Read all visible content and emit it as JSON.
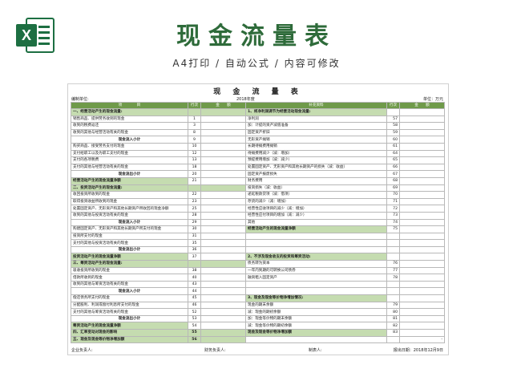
{
  "header": {
    "title": "现金流量表",
    "subtitle": "A4打印 / 自动公式 / 内容可修改"
  },
  "sheet": {
    "title": "现 金 流 量 表",
    "unit_left": "编制单位:",
    "period": "2018年度",
    "unit_right": "单位：万元",
    "col_headers": [
      "项　　　　目",
      "行次",
      "金　　额",
      "补充资料",
      "行次",
      "金　　额"
    ],
    "left_rows": [
      {
        "t": "一、经营活动产生的现金流量:",
        "n": "",
        "s": "sec"
      },
      {
        "t": "销售商品、提供劳务收到的现金",
        "n": "1",
        "s": ""
      },
      {
        "t": "收到的税费返还",
        "n": "3",
        "s": ""
      },
      {
        "t": "收到的其他与经营活动有关的现金",
        "n": "8",
        "s": ""
      },
      {
        "t": "现金流入小计",
        "n": "9",
        "s": "sub"
      },
      {
        "t": "购买商品、接受劳务支付的现金",
        "n": "10",
        "s": ""
      },
      {
        "t": "支付给职工以及为职工支付的现金",
        "n": "12",
        "s": ""
      },
      {
        "t": "支付的各项税费",
        "n": "13",
        "s": ""
      },
      {
        "t": "支付的其他与经营活动有关的现金",
        "n": "18",
        "s": ""
      },
      {
        "t": "现金流出小计",
        "n": "20",
        "s": "sub"
      },
      {
        "t": "经营活动产生的现金流量净额",
        "n": "21",
        "s": "sum"
      },
      {
        "t": "二、投资活动产生的现金流量:",
        "n": "",
        "s": "sec"
      },
      {
        "t": "收回投资所收到的现金",
        "n": "22",
        "s": ""
      },
      {
        "t": "取得投资收益所收到的现金",
        "n": "23",
        "s": ""
      },
      {
        "t": "处置固定资产、无形资产和其他长期资产所收回的现金净额",
        "n": "25",
        "s": ""
      },
      {
        "t": "收到的其他与投资活动有关的现金",
        "n": "28",
        "s": ""
      },
      {
        "t": "现金流入小计",
        "n": "29",
        "s": "sub"
      },
      {
        "t": "购建固定资产、无形资产和其他长期资产所支付的现金",
        "n": "30",
        "s": ""
      },
      {
        "t": "投资所支付的现金",
        "n": "31",
        "s": ""
      },
      {
        "t": "支付的其他与投资活动有关的现金",
        "n": "35",
        "s": ""
      },
      {
        "t": "现金流出小计",
        "n": "36",
        "s": "sub"
      },
      {
        "t": "投资活动产生的现金流量净额",
        "n": "37",
        "s": "sum"
      },
      {
        "t": "三、筹资活动产生的现金流量:",
        "n": "",
        "s": "sec"
      },
      {
        "t": "吸收投资所收到的现金",
        "n": "38",
        "s": ""
      },
      {
        "t": "借款所收到的现金",
        "n": "40",
        "s": ""
      },
      {
        "t": "收到的其他与筹资活动有关的现金",
        "n": "43",
        "s": ""
      },
      {
        "t": "现金流入小计",
        "n": "44",
        "s": "sub"
      },
      {
        "t": "偿还债务所支付的现金",
        "n": "45",
        "s": ""
      },
      {
        "t": "分配股利、利润或偿付利息所支付的现金",
        "n": "46",
        "s": ""
      },
      {
        "t": "支付的其他与筹资活动有关的现金",
        "n": "52",
        "s": ""
      },
      {
        "t": "现金流出小计",
        "n": "53",
        "s": "sub"
      },
      {
        "t": "筹资活动产生的现金流量净额",
        "n": "54",
        "s": "sum"
      },
      {
        "t": "四、汇率变动对现金的影响",
        "n": "55",
        "s": "sec"
      },
      {
        "t": "五、现金及现金等价物净增加额",
        "n": "56",
        "s": "sec"
      }
    ],
    "right_rows": [
      {
        "t": "1、将净利润调节为经营活动现金流量:",
        "n": "",
        "s": "bold"
      },
      {
        "t": "净利润",
        "n": "57",
        "s": ""
      },
      {
        "t": "加：计提的资产减值准备",
        "n": "58",
        "s": ""
      },
      {
        "t": "固定资产折旧",
        "n": "59",
        "s": ""
      },
      {
        "t": "无形资产摊销",
        "n": "60",
        "s": ""
      },
      {
        "t": "长期待摊费用摊销",
        "n": "61",
        "s": ""
      },
      {
        "t": "待摊费用减少（减：增加）",
        "n": "64",
        "s": ""
      },
      {
        "t": "预提费用增加（减：减少）",
        "n": "65",
        "s": ""
      },
      {
        "t": "处置固定资产、无形资产和其他长期资产的损失（减：收益）",
        "n": "66",
        "s": ""
      },
      {
        "t": "固定资产报废损失",
        "n": "67",
        "s": ""
      },
      {
        "t": "财务费用",
        "n": "68",
        "s": ""
      },
      {
        "t": "投资损失（减：收益）",
        "n": "69",
        "s": ""
      },
      {
        "t": "递延税款贷项（减：借项）",
        "n": "70",
        "s": ""
      },
      {
        "t": "存货的减少（减：增加）",
        "n": "71",
        "s": ""
      },
      {
        "t": "经营性应收项目的减少（减：增加）",
        "n": "72",
        "s": ""
      },
      {
        "t": "经营性应付项目的增加（减：减少）",
        "n": "73",
        "s": ""
      },
      {
        "t": "其他",
        "n": "74",
        "s": ""
      },
      {
        "t": "经营活动产生的现金流量净额",
        "n": "75",
        "s": "bold"
      },
      {
        "t": "",
        "n": "",
        "s": ""
      },
      {
        "t": "",
        "n": "",
        "s": ""
      },
      {
        "t": "",
        "n": "",
        "s": ""
      },
      {
        "t": "2、不涉及现金收支的投资和筹资活动:",
        "n": "",
        "s": "bold"
      },
      {
        "t": "债务转为资本",
        "n": "76",
        "s": ""
      },
      {
        "t": "一年内到期的可转换公司债券",
        "n": "77",
        "s": ""
      },
      {
        "t": "融资租入固定资产",
        "n": "78",
        "s": ""
      },
      {
        "t": "",
        "n": "",
        "s": ""
      },
      {
        "t": "",
        "n": "",
        "s": ""
      },
      {
        "t": "3、现金及现金等价物净增加情况:",
        "n": "",
        "s": "bold"
      },
      {
        "t": "现金的期末余额",
        "n": "79",
        "s": ""
      },
      {
        "t": "减：现金的期初余额",
        "n": "80",
        "s": ""
      },
      {
        "t": "加：现金等价物的期末余额",
        "n": "81",
        "s": ""
      },
      {
        "t": "减：现金等价物的期初余额",
        "n": "82",
        "s": ""
      },
      {
        "t": "现金及现金等价物净增加额",
        "n": "83",
        "s": "bold"
      },
      {
        "t": "",
        "n": "",
        "s": ""
      }
    ],
    "last_amount": "-",
    "footer": {
      "f1": "企业负责人:",
      "f2": "财务负责人:",
      "f3": "制表人:",
      "f4": "报出日期：2018年12月9日"
    }
  }
}
